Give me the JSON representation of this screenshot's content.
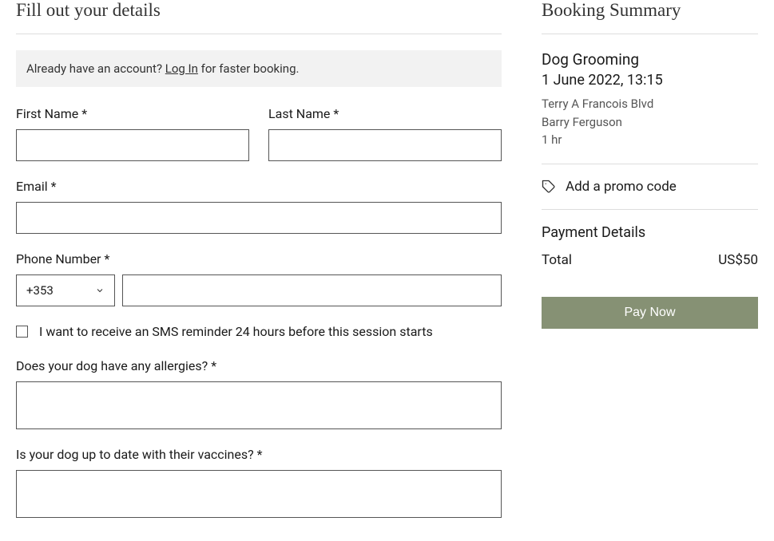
{
  "form": {
    "title": "Fill out your details",
    "login_prompt": "Already have an account? ",
    "login_link": "Log In",
    "login_suffix": " for faster booking.",
    "first_name_label": "First Name *",
    "last_name_label": "Last Name *",
    "email_label": "Email *",
    "phone_label": "Phone Number *",
    "phone_code": "+353",
    "sms_checkbox_label": "I want to receive an SMS reminder 24 hours before this session starts",
    "allergies_label": "Does your dog have any allergies? *",
    "vaccines_label": "Is your dog up to date with their vaccines? *"
  },
  "summary": {
    "title": "Booking Summary",
    "service": "Dog Grooming",
    "date_time": "1 June 2022, 13:15",
    "location": "Terry A Francois Blvd",
    "staff": "Barry Ferguson",
    "duration": "1 hr",
    "promo_link": "Add a promo code",
    "payment_details_title": "Payment Details",
    "total_label": "Total",
    "total_amount": "US$50",
    "pay_button": "Pay Now"
  }
}
